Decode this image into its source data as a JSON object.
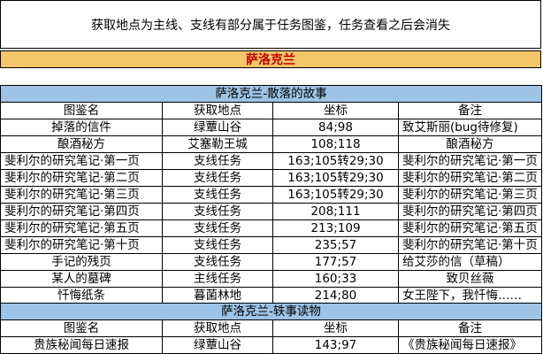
{
  "note": "获取地点为主线、支线有部分属于任务图鉴，任务查看之后会消失",
  "region": "萨洛克兰",
  "columns": [
    "图鉴名",
    "获取地点",
    "坐标",
    "备注"
  ],
  "section1": {
    "title": "萨洛克兰-散落的故事",
    "rows": [
      {
        "name": "掉落的信件",
        "loc": "绿蕈山谷",
        "coord": "84;98",
        "note": "致艾斯丽(bug待修复)"
      },
      {
        "name": "酿酒秘方",
        "loc": "艾塞勒王城",
        "coord": "108;118",
        "note": "酿酒秘方"
      },
      {
        "name": "斐利尔的研究笔记·第一页",
        "loc": "支线任务",
        "coord": "163;105转29;30",
        "note": "斐利尔的研究笔记·第一页"
      },
      {
        "name": "斐利尔的研究笔记·第二页",
        "loc": "支线任务",
        "coord": "163;105转29;30",
        "note": "斐利尔的研究笔记·第二页"
      },
      {
        "name": "斐利尔的研究笔记·第三页",
        "loc": "支线任务",
        "coord": "163;105转29;30",
        "note": "斐利尔的研究笔记·第三页"
      },
      {
        "name": "斐利尔的研究笔记·第四页",
        "loc": "支线任务",
        "coord": "208;111",
        "note": "斐利尔的研究笔记·第四页"
      },
      {
        "name": "斐利尔的研究笔记·第五页",
        "loc": "支线任务",
        "coord": "213;109",
        "note": "斐利尔的研究笔记·第五页"
      },
      {
        "name": "斐利尔的研究笔记·第十页",
        "loc": "支线任务",
        "coord": "235;57",
        "note": "斐利尔的研究笔记·第十页"
      },
      {
        "name": "手记的残页",
        "loc": "支线任务",
        "coord": "177;57",
        "note": "给艾莎的信（草稿）"
      },
      {
        "name": "某人的墓碑",
        "loc": "主线任务",
        "coord": "160;33",
        "note": "致贝丝薇"
      },
      {
        "name": "忏悔纸条",
        "loc": "暮菌林地",
        "coord": "214;80",
        "note": "女王陛下，我忏悔……"
      }
    ]
  },
  "section2": {
    "title": "萨洛克兰-轶事读物",
    "rows": [
      {
        "name": "贵族秘闻每日速报",
        "loc": "绿蕈山谷",
        "coord": "143;97",
        "note": "《贵族秘闻每日速报》"
      }
    ]
  }
}
